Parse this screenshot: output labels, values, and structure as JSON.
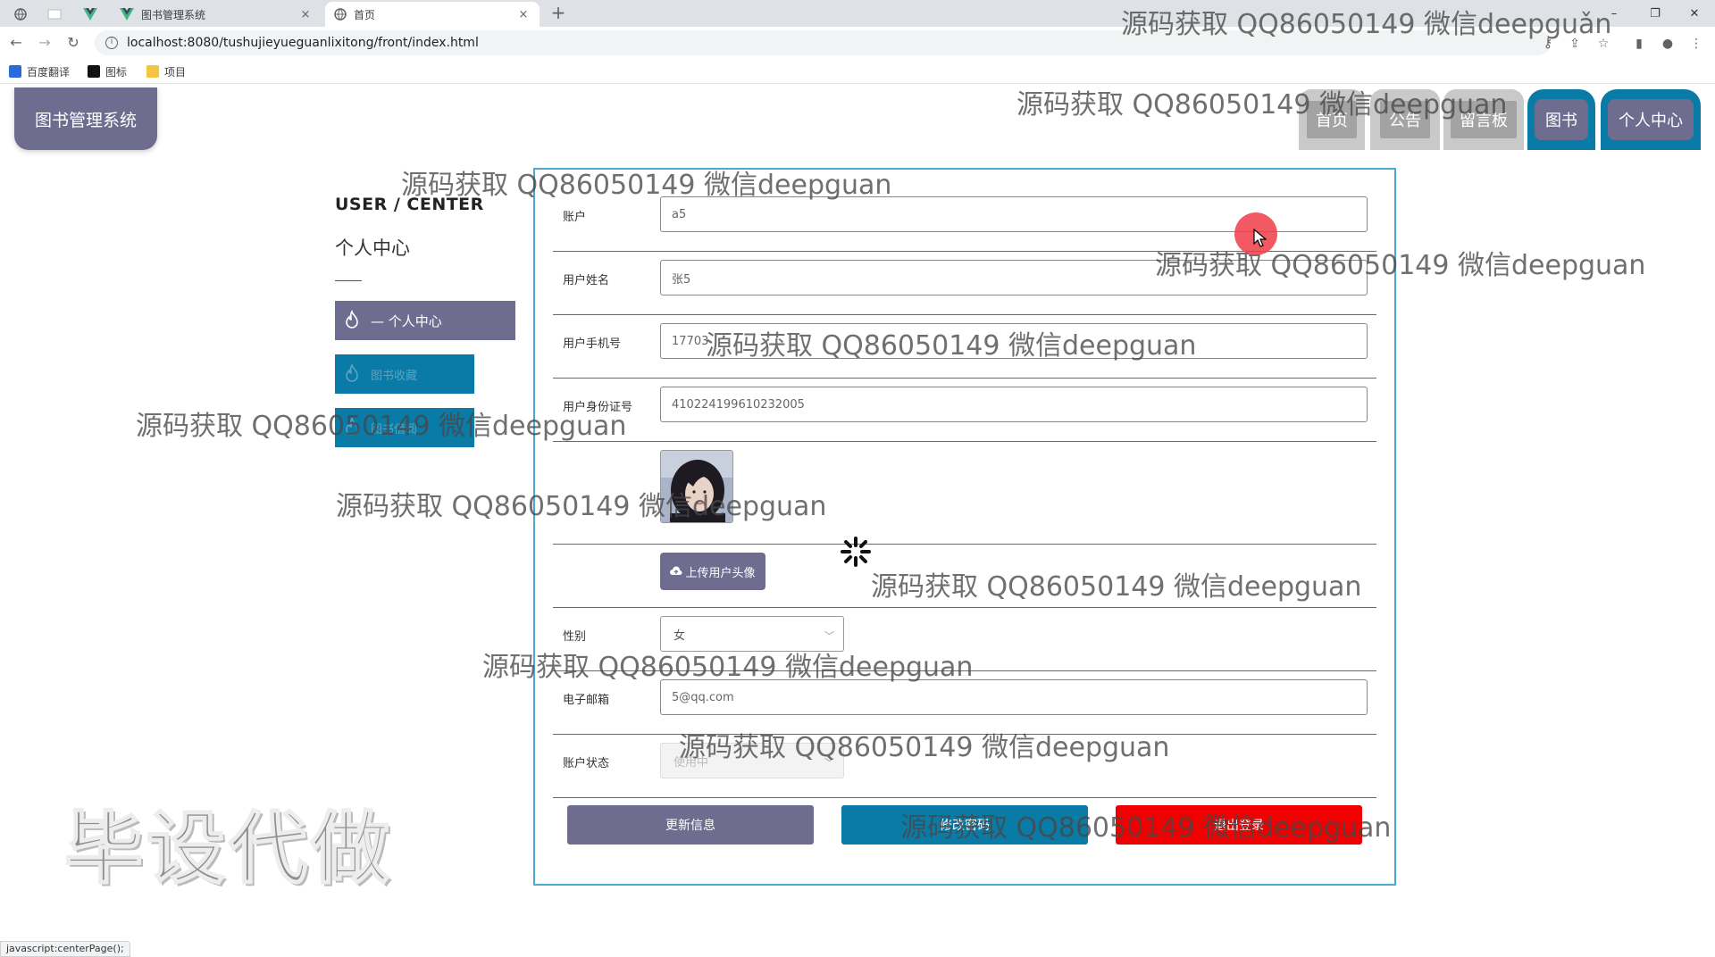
{
  "browser": {
    "tabs": [
      {
        "title": "图书管理系统",
        "close": "×"
      },
      {
        "title": "首页",
        "close": "×"
      }
    ],
    "new_tab": "+",
    "window_controls": {
      "minimize": "–",
      "restore": "❐",
      "close": "✕"
    },
    "url": "localhost:8080/tushujieyueguanlixitong/front/index.html",
    "bookmarks": [
      {
        "label": "百度翻译",
        "color": "#2a6ad8"
      },
      {
        "label": "图标",
        "color": "#111111"
      },
      {
        "label": "项目",
        "color": "#f5c542"
      }
    ],
    "status_url": "javascript:centerPage();"
  },
  "site": {
    "logo": "图书管理系统",
    "nav": [
      "首页",
      "公告",
      "留言板",
      "图书",
      "个人中心"
    ]
  },
  "sidebar": {
    "title_en": "USER / CENTER",
    "title_cn": "个人中心",
    "items": [
      {
        "label": "— 个人中心"
      },
      {
        "label": "图书收藏"
      },
      {
        "label": "图书借阅"
      }
    ]
  },
  "form": {
    "fields": {
      "account": {
        "label": "账户",
        "value": "a5"
      },
      "name": {
        "label": "用户姓名",
        "value": "张5"
      },
      "phone": {
        "label": "用户手机号",
        "value": "17703"
      },
      "id_card": {
        "label": "用户身份证号",
        "value": "410224199610232005"
      },
      "gender": {
        "label": "性别",
        "value": "女"
      },
      "email": {
        "label": "电子邮箱",
        "value": "5@qq.com"
      },
      "status": {
        "label": "账户状态",
        "value": "使用中"
      }
    },
    "upload_label": "上传用户头像",
    "buttons": {
      "update": "更新信息",
      "change_password": "修改密码",
      "logout": "退出登录"
    }
  },
  "watermarks": [
    "源码获取 QQ86050149 微信deepguǎn",
    "源码获取 QQ86050149 微信deepguan",
    "源码获取 QQ86050149 微信deepguan",
    "源码获取 QQ86050149 微信deepguan",
    "源码获取 QQ86050149 微信deepguan",
    "源码获取 QQ86050149 微信deepguan",
    "源码获取 QQ86050149 微信deepguan",
    "源码获取 QQ86050149 微信deepguan",
    "源码获取 QQ86050149 微信deepguan",
    "源码获取 QQ86050149 微信deepguan",
    "源码获取 QQ86050149 微信deepguan"
  ],
  "corner_watermark": "毕设代做",
  "colors": {
    "primary_purple": "#6f6d8f",
    "teal": "#0a7ba7",
    "logout_red": "#f00000",
    "card_border": "#4ba9d0"
  }
}
